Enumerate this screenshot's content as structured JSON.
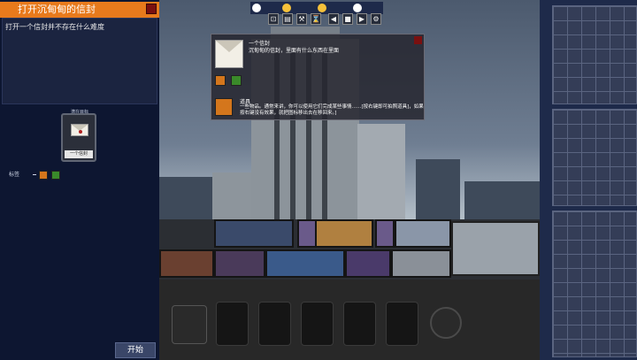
{
  "task": {
    "title": "打开沉甸甸的信封",
    "description": "打开一个信封并不存在什么难度"
  },
  "card": {
    "caption": "潜在目标",
    "name": "一个信封"
  },
  "tags": {
    "label": "标签"
  },
  "start_button": "开始",
  "popup": {
    "title": "一个信封",
    "description": "沉甸甸的信封，里面有什么东西在里面",
    "sub_title": "道具",
    "sub_description": "一些物品。通常来讲，你可以使用它们完成某些事情……[按右键即可拍照道具]，如果按右键没有效果，就把图标移出去在移回来。]"
  },
  "toolbar": {
    "buttons": [
      "⊡",
      "▤",
      "⚒",
      "⌛",
      "◀",
      "■",
      "▶",
      "⚙"
    ]
  },
  "colors": {
    "accent": "#e87a1c",
    "panel": "#0d1631",
    "close": "#7a1010"
  }
}
